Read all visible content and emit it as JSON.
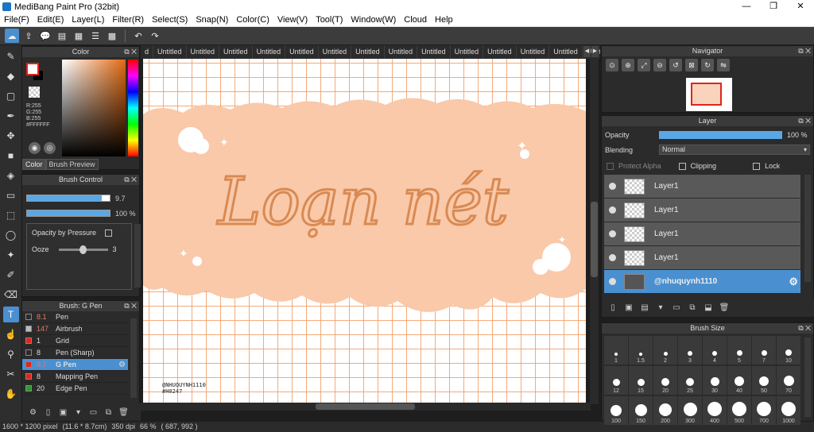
{
  "app": {
    "title": "MediBang Paint Pro (32bit)"
  },
  "window_controls": {
    "minimize": "—",
    "maximize": "❐",
    "close": "✕"
  },
  "menu": [
    "File(F)",
    "Edit(E)",
    "Layer(L)",
    "Filter(R)",
    "Select(S)",
    "Snap(N)",
    "Color(C)",
    "View(V)",
    "Tool(T)",
    "Window(W)",
    "Cloud",
    "Help"
  ],
  "color_panel": {
    "title": "Color",
    "rgb": [
      "R:255",
      "G:255",
      "B:255"
    ],
    "hex": "#FFFFFF",
    "tabs": [
      "Color",
      "Brush Preview"
    ]
  },
  "brush_control": {
    "title": "Brush Control",
    "size_value": "9.7",
    "opacity_value": "100 %",
    "opacity_by_pressure": "Opacity by Pressure",
    "ooze_label": "Ooze",
    "ooze_value": "3",
    "size_fill": 0.9,
    "opacity_fill": 1.0,
    "ooze_level": 0.5
  },
  "brush_list": {
    "title": "Brush: G Pen",
    "items": [
      {
        "size": "8.1",
        "name": "Pen",
        "color": "#2b2b2b",
        "size_color": "#e8776b"
      },
      {
        "size": "147",
        "name": "Airbrush",
        "color": "#bbbbbb",
        "size_color": "#e8776b"
      },
      {
        "size": "1",
        "name": "Grid",
        "color": "#e0251e",
        "size_color": "#dddddd"
      },
      {
        "size": "8",
        "name": "Pen (Sharp)",
        "color": "#2b2b2b",
        "size_color": "#dddddd"
      },
      {
        "size": "9.7",
        "name": "G Pen",
        "color": "#e0251e",
        "size_color": "#e8776b",
        "selected": true
      },
      {
        "size": "8",
        "name": "Mapping Pen",
        "color": "#e0251e",
        "size_color": "#dddddd"
      },
      {
        "size": "20",
        "name": "Edge Pen",
        "color": "#2a9d2a",
        "size_color": "#dddddd"
      }
    ]
  },
  "tabs": [
    "d",
    "Untitled",
    "Untitled",
    "Untitled",
    "Untitled",
    "Untitled",
    "Untitled",
    "Untitled",
    "Untitled",
    "Untitled",
    "Untitled",
    "Untitled",
    "Untitled",
    "Untitled",
    "Untitled",
    "Untitled"
  ],
  "tab_arrows": {
    "prev": "◀",
    "next": "▶"
  },
  "canvas": {
    "title_text": "Loạn nét",
    "watermark_line1": "@NHUQUYNH1110",
    "watermark_line2": "#H0247",
    "peach": "#f9c9aa",
    "ink": "#d98a52"
  },
  "status": {
    "size": "1600 * 1200 pixel",
    "cm": "(11.6 * 8.7cm)",
    "dpi": "350 dpi",
    "zoom": "66 %",
    "coords": "( 687, 992 )"
  },
  "navigator": {
    "title": "Navigator"
  },
  "layer_panel": {
    "title": "Layer",
    "opacity_label": "Opacity",
    "opacity_value": "100 %",
    "opacity_level": 1.0,
    "blending_label": "Blending",
    "blending_value": "Normal",
    "protect_alpha": "Protect Alpha",
    "clipping": "Clipping",
    "lock": "Lock",
    "layers": [
      "Layer1",
      "Layer1",
      "Layer1",
      "Layer1",
      "@nhuquynh1110"
    ]
  },
  "brush_size": {
    "title": "Brush Size",
    "sizes": [
      "1",
      "1.5",
      "2",
      "3",
      "4",
      "5",
      "7",
      "10",
      "12",
      "15",
      "20",
      "25",
      "30",
      "40",
      "50",
      "70",
      "100",
      "150",
      "200",
      "300",
      "400",
      "500",
      "700",
      "1000"
    ]
  }
}
